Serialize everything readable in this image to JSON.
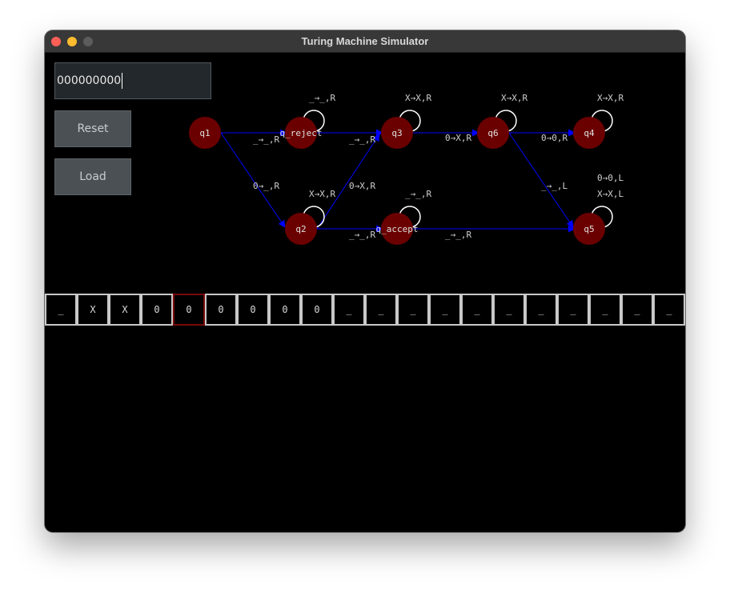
{
  "window": {
    "title": "Turing Machine Simulator"
  },
  "controls": {
    "input_value": "000000000",
    "reset_label": "Reset",
    "load_label": "Load"
  },
  "colors": {
    "state_fill": "#6b0000",
    "edge": "#0000ff",
    "loop": "#ffffff",
    "label": "#d0d0d0",
    "head_border": "#7a0a0a"
  },
  "states": [
    {
      "id": "q1",
      "label": "q1"
    },
    {
      "id": "q_reject",
      "label": "q_reject"
    },
    {
      "id": "q3",
      "label": "q3"
    },
    {
      "id": "q6",
      "label": "q6"
    },
    {
      "id": "q4",
      "label": "q4"
    },
    {
      "id": "q2",
      "label": "q2"
    },
    {
      "id": "q_accept",
      "label": "q_accept"
    },
    {
      "id": "q5",
      "label": "q5"
    }
  ],
  "edge_labels": [
    "_→_,R",
    "_→_,R",
    "0→X,R",
    "0→0,R",
    "0→_,R",
    "0→X,R",
    "_→_,R",
    "_→_,R",
    "_→_,L",
    "_→_,R",
    "X→X,R",
    "X→X,R",
    "X→X,R",
    "X→X,R",
    "_→_,R",
    "0→0,L",
    "X→X,L"
  ],
  "tape": {
    "cells": [
      "_",
      "X",
      "X",
      "0",
      "0",
      "0",
      "0",
      "0",
      "0",
      "_",
      "_",
      "_",
      "_",
      "_",
      "_",
      "_",
      "_",
      "_",
      "_",
      "_"
    ],
    "head_index": 4
  }
}
